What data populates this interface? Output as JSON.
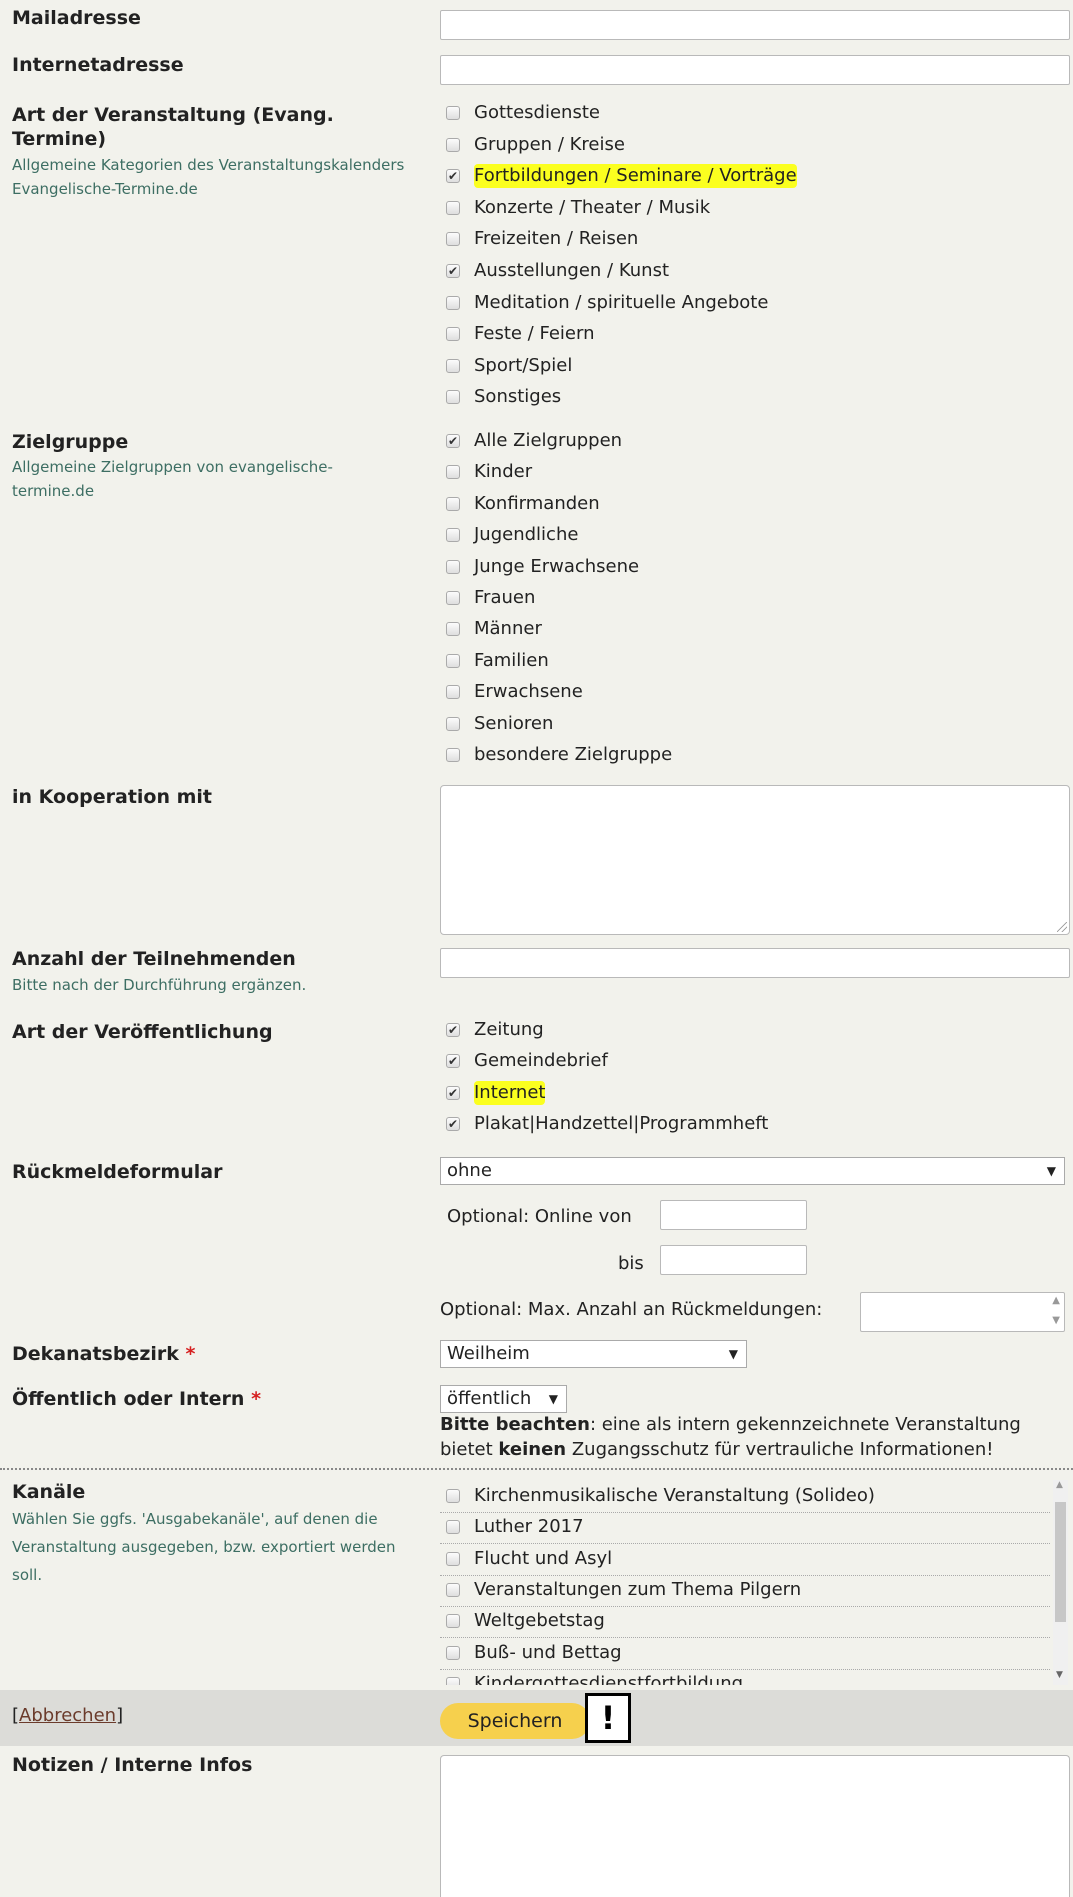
{
  "fields": {
    "mail_label": "Mailadresse",
    "web_label": "Internetadresse",
    "art_label": "Art der Veranstaltung (Evang. Termine)",
    "art_sub": "Allgemeine Kategorien des Veranstaltungskalenders Evangelische-Termine.de",
    "ziel_label": "Zielgruppe",
    "ziel_sub": "Allgemeine Zielgruppen von evangelische-termine.de",
    "koop_label": "in Kooperation mit",
    "anzahl_label": "Anzahl der Teilnehmenden",
    "anzahl_sub": "Bitte nach der Durchführung ergänzen.",
    "veroeff_label": "Art der Veröffentlichung",
    "rueck_label": "Rückmeldeformular",
    "rueck_select": "ohne",
    "online_von": "Optional: Online von",
    "bis": "bis",
    "max_anzahl": "Optional: Max. Anzahl an Rückmeldungen:",
    "dekanat_label": "Dekanatsbezirk",
    "dekanat_select": "Weilheim",
    "oeff_label": "Öffentlich oder Intern",
    "oeff_select": "öffentlich",
    "note_bold1": "Bitte beachten",
    "note_part1": ": eine als intern gekennzeichnete Veranstaltung",
    "note_part2": "bietet ",
    "note_bold2": "keinen",
    "note_part3": " Zugangsschutz für vertrauliche Informationen!",
    "kanaele_label": "Kanäle",
    "kanaele_sub": "Wählen Sie ggfs. 'Ausgabekanäle', auf denen die Veranstaltung ausgegeben, bzw. exportiert werden soll.",
    "notizen_label": "Notizen / Interne Infos",
    "required_mark": "*"
  },
  "art_options": [
    {
      "label": "Gottesdienste",
      "checked": false,
      "highlight": false
    },
    {
      "label": "Gruppen / Kreise",
      "checked": false,
      "highlight": false
    },
    {
      "label": "Fortbildungen / Seminare / Vorträge",
      "checked": true,
      "highlight": true
    },
    {
      "label": "Konzerte / Theater / Musik",
      "checked": false,
      "highlight": false
    },
    {
      "label": "Freizeiten / Reisen",
      "checked": false,
      "highlight": false
    },
    {
      "label": "Ausstellungen / Kunst",
      "checked": true,
      "highlight": false
    },
    {
      "label": "Meditation / spirituelle Angebote",
      "checked": false,
      "highlight": false
    },
    {
      "label": "Feste / Feiern",
      "checked": false,
      "highlight": false
    },
    {
      "label": "Sport/Spiel",
      "checked": false,
      "highlight": false
    },
    {
      "label": "Sonstiges",
      "checked": false,
      "highlight": false
    }
  ],
  "ziel_options": [
    {
      "label": "Alle Zielgruppen",
      "checked": true
    },
    {
      "label": "Kinder",
      "checked": false
    },
    {
      "label": "Konfirmanden",
      "checked": false
    },
    {
      "label": "Jugendliche",
      "checked": false
    },
    {
      "label": "Junge Erwachsene",
      "checked": false
    },
    {
      "label": "Frauen",
      "checked": false
    },
    {
      "label": "Männer",
      "checked": false
    },
    {
      "label": "Familien",
      "checked": false
    },
    {
      "label": "Erwachsene",
      "checked": false
    },
    {
      "label": "Senioren",
      "checked": false
    },
    {
      "label": "besondere Zielgruppe",
      "checked": false
    }
  ],
  "veroeff_options": [
    {
      "label": "Zeitung",
      "checked": true,
      "highlight": false
    },
    {
      "label": "Gemeindebrief",
      "checked": true,
      "highlight": false
    },
    {
      "label": "Internet",
      "checked": true,
      "highlight": true
    },
    {
      "label": "Plakat|Handzettel|Programmheft",
      "checked": true,
      "highlight": false
    }
  ],
  "kanaele_options": [
    {
      "label": "Kirchenmusikalische Veranstaltung (Solideo)",
      "checked": false
    },
    {
      "label": "Luther 2017",
      "checked": false
    },
    {
      "label": "Flucht und Asyl",
      "checked": false
    },
    {
      "label": "Veranstaltungen zum Thema Pilgern",
      "checked": false
    },
    {
      "label": "Weltgebetstag",
      "checked": false
    },
    {
      "label": "Buß- und Bettag",
      "checked": false
    },
    {
      "label": "Kindergottesdienstfortbildung",
      "checked": false
    }
  ],
  "actions": {
    "cancel_prefix": "[",
    "cancel_label": "Abbrechen",
    "cancel_suffix": "]",
    "save_label": "Speichern",
    "warning_mark": "!"
  },
  "colors": {
    "highlight": "#fbff1f",
    "save_button": "#f6d04d",
    "sub_text": "#3d6e63",
    "required": "#d62020"
  },
  "icons": [
    "checkmark-icon",
    "dropdown-arrow-icon",
    "spinner-up-icon",
    "spinner-down-icon",
    "scroll-up-icon",
    "scroll-down-icon",
    "resize-grip-icon"
  ]
}
